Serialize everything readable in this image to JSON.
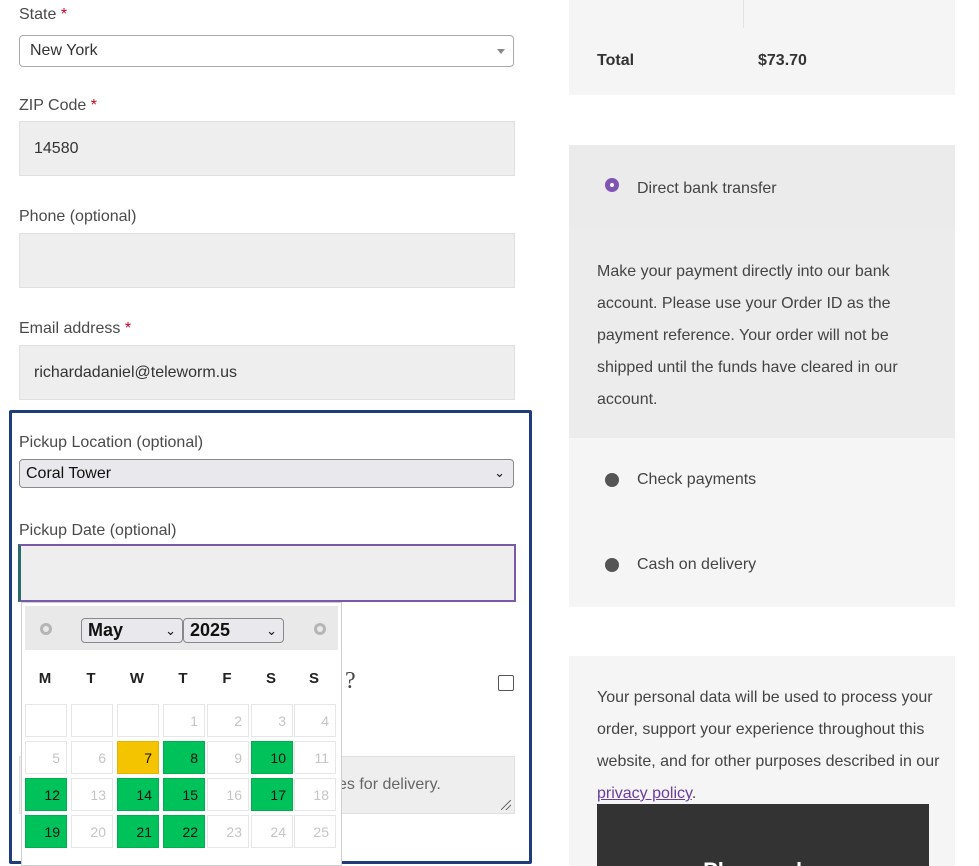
{
  "billing": {
    "state_label": "State",
    "required_mark": "*",
    "state_value": "New York",
    "zip_label": "ZIP Code",
    "zip_value": "14580",
    "phone_label": "Phone (optional)",
    "phone_value": "",
    "email_label": "Email address",
    "email_value": "richardadaniel@teleworm.us"
  },
  "pickup": {
    "location_label": "Pickup Location (optional)",
    "location_value": "Coral Tower",
    "date_label": "Pickup Date (optional)",
    "date_value": "",
    "hidden_question_tail": "?",
    "notes_visible_text": "es for delivery."
  },
  "datepicker": {
    "month": "May",
    "year": "2025",
    "weekdays": [
      "M",
      "T",
      "W",
      "T",
      "F",
      "S",
      "S"
    ],
    "rows": [
      [
        {
          "d": "",
          "s": "none"
        },
        {
          "d": "",
          "s": "none"
        },
        {
          "d": "",
          "s": "none"
        },
        {
          "d": "1",
          "s": "disabled"
        },
        {
          "d": "2",
          "s": "disabled"
        },
        {
          "d": "3",
          "s": "disabled"
        },
        {
          "d": "4",
          "s": "disabled"
        }
      ],
      [
        {
          "d": "5",
          "s": "disabled"
        },
        {
          "d": "6",
          "s": "disabled"
        },
        {
          "d": "7",
          "s": "today"
        },
        {
          "d": "8",
          "s": "avail"
        },
        {
          "d": "9",
          "s": "disabled"
        },
        {
          "d": "10",
          "s": "avail"
        },
        {
          "d": "11",
          "s": "disabled"
        }
      ],
      [
        {
          "d": "12",
          "s": "avail"
        },
        {
          "d": "13",
          "s": "disabled"
        },
        {
          "d": "14",
          "s": "avail"
        },
        {
          "d": "15",
          "s": "avail"
        },
        {
          "d": "16",
          "s": "disabled"
        },
        {
          "d": "17",
          "s": "avail"
        },
        {
          "d": "18",
          "s": "disabled"
        }
      ],
      [
        {
          "d": "19",
          "s": "avail"
        },
        {
          "d": "20",
          "s": "disabled"
        },
        {
          "d": "21",
          "s": "avail"
        },
        {
          "d": "22",
          "s": "avail"
        },
        {
          "d": "23",
          "s": "disabled"
        },
        {
          "d": "24",
          "s": "disabled"
        },
        {
          "d": "25",
          "s": "disabled"
        }
      ]
    ],
    "colors": {
      "available": "#00c25a",
      "today": "#f5c400"
    }
  },
  "order": {
    "total_label": "Total",
    "total_value": "$73.70"
  },
  "payment": {
    "methods": [
      {
        "label": "Direct bank transfer",
        "selected": true
      },
      {
        "label": "Check payments",
        "selected": false
      },
      {
        "label": "Cash on delivery",
        "selected": false
      }
    ],
    "bank_description": "Make your payment directly into our bank account. Please use your Order ID as the payment reference. Your order will not be shipped until the funds have cleared in our account.",
    "accent_color": "#7f54b3"
  },
  "privacy": {
    "text_before": "Your personal data will be used to process your order, support your experience throughout this website, and for other purposes described in our ",
    "link_text": "privacy policy",
    "text_after": "."
  },
  "place_order": {
    "label": "Place order"
  }
}
